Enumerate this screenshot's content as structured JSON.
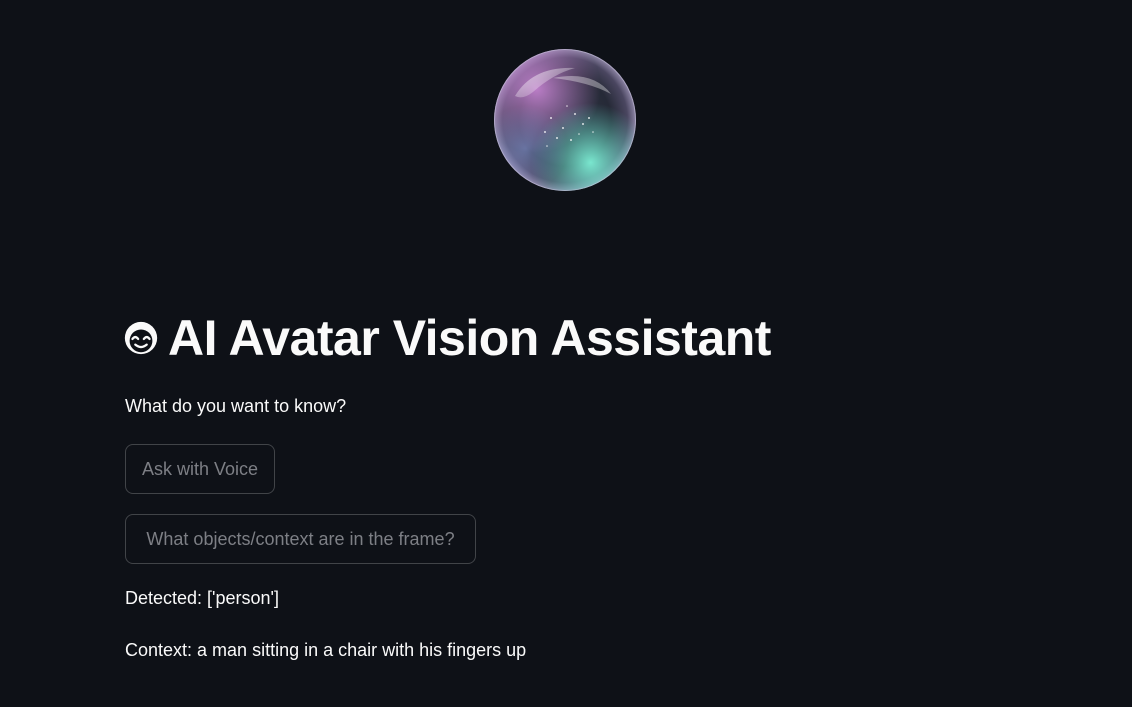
{
  "avatar": {
    "image": "glass-bubble-orb",
    "colors": [
      "#c07ad6",
      "#5fe0c8",
      "#2a2d3a"
    ]
  },
  "header": {
    "icon": "smiling-face-icon",
    "title": "AI Avatar Vision Assistant"
  },
  "main": {
    "prompt": "What do you want to know?",
    "voice_button_label": "Ask with Voice",
    "objects_button_label": "What objects/context are in the frame?",
    "detected_text": "Detected: ['person']",
    "context_text": "Context: a man sitting in a chair with his fingers up"
  },
  "theme": {
    "background": "#0e1117",
    "text": "#fafafa",
    "muted_text": "#7d7f85"
  }
}
